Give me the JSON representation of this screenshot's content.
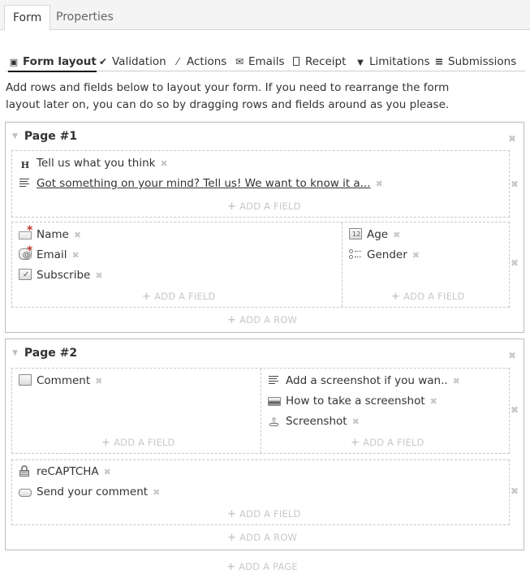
{
  "top_tabs": [
    {
      "label": "Form",
      "active": true
    },
    {
      "label": "Properties",
      "active": false
    }
  ],
  "sub_tabs": [
    {
      "label": "Form layout",
      "icon": "layout-icon",
      "glyph": "▣",
      "active": true
    },
    {
      "label": "Validation",
      "icon": "check-icon",
      "glyph": "✔",
      "active": false
    },
    {
      "label": "Actions",
      "icon": "magic-wand-icon",
      "glyph": "⚡",
      "active": false
    },
    {
      "label": "Emails",
      "icon": "envelope-icon",
      "glyph": "✉",
      "active": false
    },
    {
      "label": "Receipt",
      "icon": "file-icon",
      "glyph": "🗋",
      "active": false
    },
    {
      "label": "Limitations",
      "icon": "filter-icon",
      "glyph": "▼",
      "active": false
    },
    {
      "label": "Submissions",
      "icon": "list-icon",
      "glyph": "≡",
      "active": false
    }
  ],
  "intro": "Add rows and fields below to layout your form. If you need to rearrange the form layout later on, you can do so by dragging rows and fields around as you please.",
  "remove_glyph": "✖",
  "collapse_glyph": "▼",
  "add_plus": "+",
  "add_field_label": "ADD A FIELD",
  "add_row_label": "ADD A ROW",
  "add_page_label": "ADD A PAGE",
  "required_mark": "*",
  "pages": [
    {
      "title": "Page #1",
      "rows": [
        {
          "columns": [
            {
              "fields": [
                {
                  "label": "Tell us what you think",
                  "icon": "heading-icon",
                  "glyph": "H"
                },
                {
                  "label": "Got something on your mind? Tell us! We want to know it a...",
                  "icon": "paragraph-icon",
                  "link": true
                }
              ]
            }
          ]
        },
        {
          "columns": [
            {
              "fields": [
                {
                  "label": "Name",
                  "icon": "text-input-icon",
                  "required": true
                },
                {
                  "label": "Email",
                  "icon": "email-input-icon",
                  "required": true
                },
                {
                  "label": "Subscribe",
                  "icon": "checkbox-icon"
                }
              ]
            },
            {
              "fields": [
                {
                  "label": "Age",
                  "icon": "number-input-icon"
                },
                {
                  "label": "Gender",
                  "icon": "radio-list-icon"
                }
              ]
            }
          ]
        }
      ]
    },
    {
      "title": "Page #2",
      "rows": [
        {
          "columns": [
            {
              "fields": [
                {
                  "label": "Comment",
                  "icon": "textarea-icon"
                }
              ]
            },
            {
              "fields": [
                {
                  "label": "Add a screenshot if you wan..",
                  "icon": "paragraph-icon"
                },
                {
                  "label": "How to take a screenshot",
                  "icon": "image-icon"
                },
                {
                  "label": "Screenshot",
                  "icon": "upload-icon"
                }
              ]
            }
          ]
        },
        {
          "columns": [
            {
              "fields": [
                {
                  "label": "reCAPTCHA",
                  "icon": "lock-icon"
                },
                {
                  "label": "Send your comment",
                  "icon": "button-icon"
                }
              ]
            }
          ]
        }
      ]
    }
  ]
}
